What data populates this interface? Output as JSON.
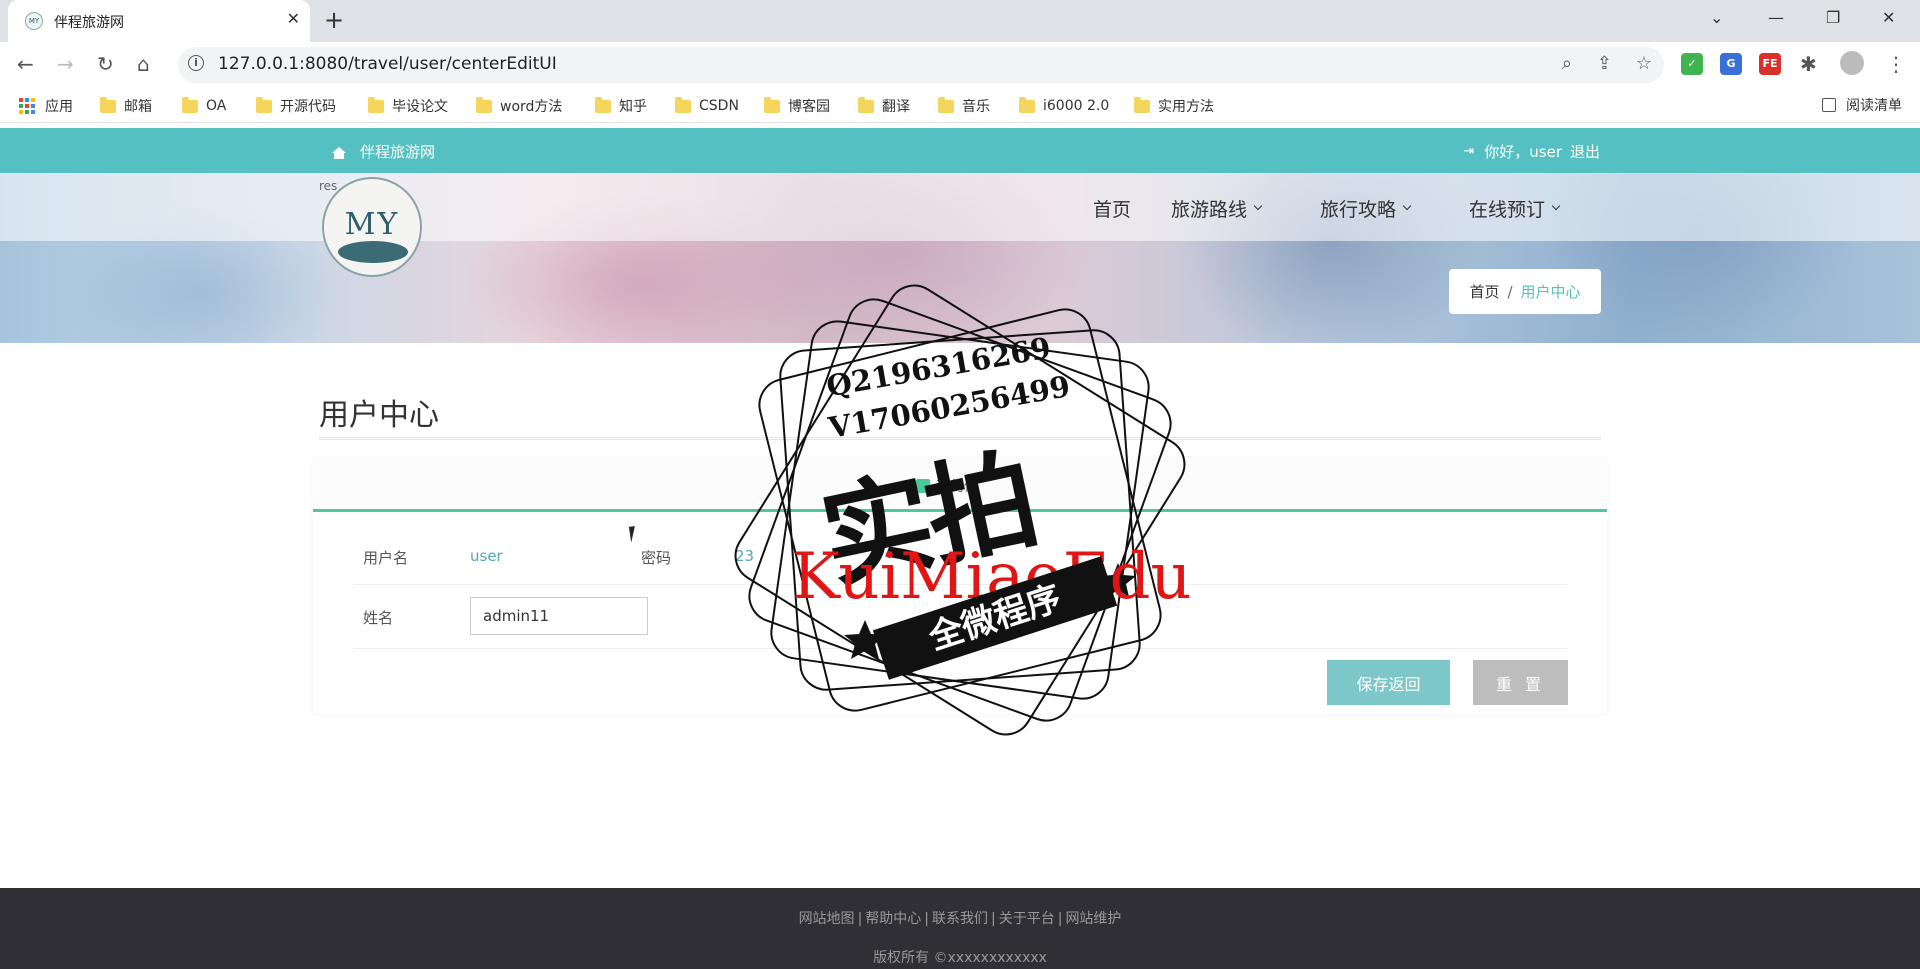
{
  "browser": {
    "tab_title": "伴程旅游网",
    "favicon_text": "MY",
    "new_tab": "+",
    "tab_close": "✕",
    "url": "127.0.0.1:8080/travel/user/centerEditUI",
    "bookmarks": [
      {
        "label": "应用",
        "type": "apps"
      },
      {
        "label": "邮箱",
        "type": "folder"
      },
      {
        "label": "OA",
        "type": "folder"
      },
      {
        "label": "开源代码",
        "type": "folder"
      },
      {
        "label": "毕设论文",
        "type": "folder"
      },
      {
        "label": "word方法",
        "type": "folder"
      },
      {
        "label": "知乎",
        "type": "folder"
      },
      {
        "label": "CSDN",
        "type": "folder"
      },
      {
        "label": "博客园",
        "type": "folder"
      },
      {
        "label": "翻译",
        "type": "folder"
      },
      {
        "label": "音乐",
        "type": "folder"
      },
      {
        "label": "i6000 2.0",
        "type": "folder"
      },
      {
        "label": "实用方法",
        "type": "folder"
      }
    ],
    "reading_list": "阅读清单",
    "extensions": [
      {
        "icon": "shield-icon",
        "color": "#3fb44f",
        "text": "✓"
      },
      {
        "icon": "translate-icon",
        "color": "#3a6fd8",
        "text": "G"
      },
      {
        "icon": "fe-helper-icon",
        "color": "#d9302c",
        "text": "FE"
      }
    ]
  },
  "site": {
    "name": "伴程旅游网",
    "greeting": "你好，user",
    "logout": "退出",
    "logo_text": "MY",
    "logo_tag": "res",
    "nav": [
      {
        "label": "首页",
        "has_dropdown": false
      },
      {
        "label": "旅游路线",
        "has_dropdown": true
      },
      {
        "label": "旅行攻略",
        "has_dropdown": true
      },
      {
        "label": "在线预订",
        "has_dropdown": true
      }
    ],
    "breadcrumb": {
      "home": "首页",
      "separator": "/",
      "current": "用户中心"
    }
  },
  "main": {
    "page_title": "用户中心",
    "panel_tab": "我的信",
    "form": {
      "username_label": "用户名",
      "username_value": "user",
      "password_label": "密码",
      "password_value": "23",
      "name_label": "姓名",
      "name_value": "admin11"
    },
    "save_button": "保存返回",
    "reset_button": "重 置"
  },
  "footer": {
    "links": [
      "网站地图",
      "帮助中心",
      "联系我们",
      "关于平台",
      "网站维护"
    ],
    "copyright": "版权所有 ©xxxxxxxxxxxx"
  },
  "watermark": {
    "line1": "Q2196316269",
    "line2": "V17060256499",
    "big": "实拍",
    "red": "KuiMiaoEdu",
    "ribbon": "全微程序"
  }
}
